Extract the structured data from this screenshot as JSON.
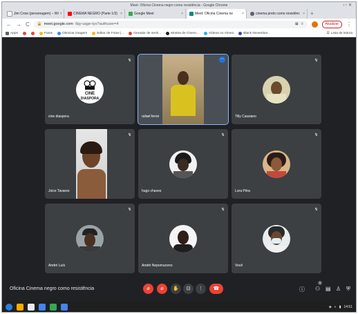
{
  "window": {
    "title": "Meet: Oficina Cinema negro como resistência - Google Chrome",
    "controls": "‹ ▫ ✕"
  },
  "tabs": [
    {
      "label": "Jim Crow (personagem) – Wi",
      "color": "#ffffff"
    },
    {
      "label": "CINEMA NEGRO (Parte 1/3)",
      "color": "#ff0000"
    },
    {
      "label": "Google Meet",
      "color": "#34a853"
    },
    {
      "label": "Meet: Oficina Cinema ne",
      "color": "#00897b"
    },
    {
      "label": "cinema preto como resistênc",
      "color": "#5f6368"
    }
  ],
  "newtab": "+",
  "toolbar": {
    "back": "←",
    "forward": "→",
    "reload": "C",
    "url_host": "meet.google.com",
    "url_path": "/bjy-uqge-tyo?authuser=4",
    "update_label": "Atualizar",
    "icons": [
      "translate-icon",
      "star-icon"
    ]
  },
  "bookmarks": [
    {
      "label": "Apps",
      "color": "#5f6368"
    },
    {
      "label": "",
      "color": "#ea4335"
    },
    {
      "label": "",
      "color": "#ea4335"
    },
    {
      "label": "Fotos",
      "color": "#fbbc04"
    },
    {
      "label": "Otimizar imagem",
      "color": "#4285f4"
    },
    {
      "label": "Editor de Fotos |...",
      "color": "#fbbc04"
    },
    {
      "label": "Gerador de senh...",
      "color": "#ea4335"
    },
    {
      "label": "Mostra de Cinem...",
      "color": "#202124"
    },
    {
      "label": "Vídeos no Vimeo",
      "color": "#1ab7ea"
    },
    {
      "label": "Black November...",
      "color": "#3949ab"
    }
  ],
  "bookmarks_right": "Lista de leitura",
  "participants": [
    {
      "name": "cine diaspora",
      "logo_text": "CINE\nDIASPORA"
    },
    {
      "name": "rafael ferrei"
    },
    {
      "name": "Tilly Cassiano"
    },
    {
      "name": "Joice Tavares"
    },
    {
      "name": "hugo chaves"
    },
    {
      "name": "Lora Pêra"
    },
    {
      "name": "André Luís"
    },
    {
      "name": "André Nepomuceno"
    },
    {
      "name": "Você"
    }
  ],
  "mic_icon": "↯",
  "more_icon": "⋯",
  "meeting": {
    "title": "Oficina Cinema negro como resistência",
    "participant_count": "9"
  },
  "controls": {
    "mic": "⌀",
    "cam": "⌀",
    "hand": "✋",
    "present": "⊡",
    "more": "⋮",
    "end": "☎"
  },
  "right_controls": {
    "info": "ⓘ",
    "people": "⚇",
    "chat": "▤",
    "activities": "♙",
    "safety": "⛨"
  },
  "taskbar": {
    "apps": [
      "#2a7de1",
      "#f9ab00",
      "#e8eaed",
      "#4285f4",
      "#34a853",
      "#4285f4"
    ],
    "clock": "14:51"
  }
}
